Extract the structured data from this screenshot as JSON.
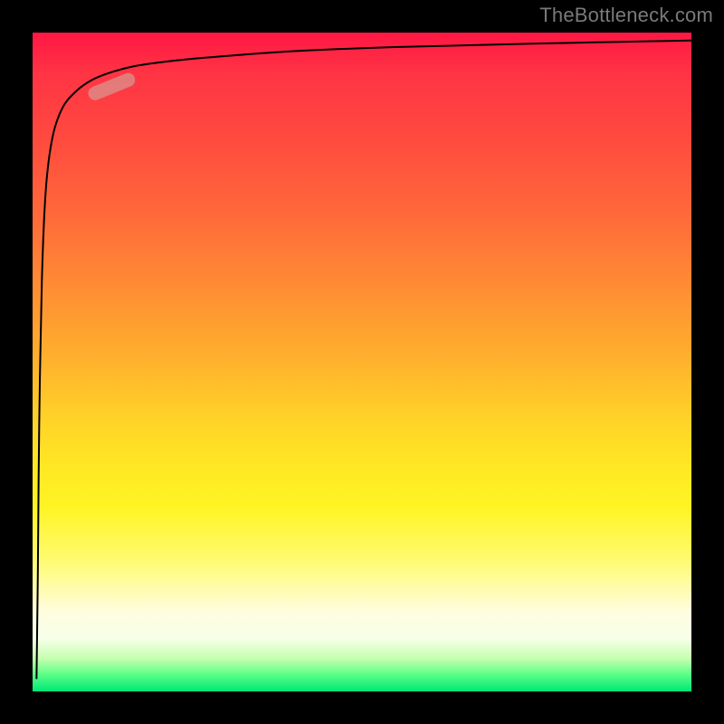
{
  "watermark": "TheBottleneck.com",
  "chart_data": {
    "type": "line",
    "title": "",
    "xlabel": "",
    "ylabel": "",
    "xlim": [
      0,
      100
    ],
    "ylim": [
      0,
      100
    ],
    "grid": false,
    "legend": false,
    "gradient_stops": [
      {
        "pos": 0,
        "color": "#ff1744"
      },
      {
        "pos": 6,
        "color": "#ff3344"
      },
      {
        "pos": 16,
        "color": "#ff4a3f"
      },
      {
        "pos": 28,
        "color": "#ff6a3a"
      },
      {
        "pos": 38,
        "color": "#ff8a34"
      },
      {
        "pos": 48,
        "color": "#ffab2e"
      },
      {
        "pos": 58,
        "color": "#ffd028"
      },
      {
        "pos": 66,
        "color": "#ffe824"
      },
      {
        "pos": 72,
        "color": "#fff423"
      },
      {
        "pos": 80,
        "color": "#fffb70"
      },
      {
        "pos": 88,
        "color": "#fffde0"
      },
      {
        "pos": 92,
        "color": "#f6ffe8"
      },
      {
        "pos": 95,
        "color": "#c6ffb0"
      },
      {
        "pos": 97.5,
        "color": "#58ff86"
      },
      {
        "pos": 100,
        "color": "#00e676"
      }
    ],
    "series": [
      {
        "name": "curve",
        "color": "#000000",
        "stroke_width": 2,
        "x": [
          0.6,
          0.8,
          1.0,
          1.4,
          2.0,
          3.0,
          4.5,
          6.5,
          9.0,
          12.0,
          16.0,
          22.0,
          30.0,
          40.0,
          55.0,
          75.0,
          100.0
        ],
        "y": [
          2,
          18,
          40,
          62,
          76,
          84,
          88.5,
          91.0,
          92.8,
          94.0,
          95.0,
          95.8,
          96.5,
          97.2,
          97.8,
          98.3,
          98.8
        ]
      }
    ],
    "highlight_pill": {
      "cx": 12.0,
      "cy": 91.8,
      "color": "#d9938e",
      "opacity": 0.75,
      "length_pct": 7.5,
      "thickness_pct": 2.1,
      "angle_deg": -22
    }
  }
}
